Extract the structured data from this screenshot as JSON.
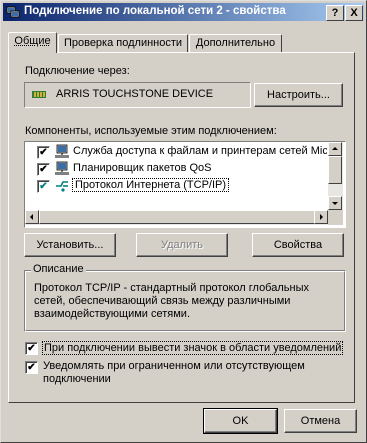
{
  "window": {
    "title": "Подключение по локальной сети 2 - свойства",
    "help_glyph": "?",
    "close_glyph": "X"
  },
  "tabs": [
    {
      "label": "Общие",
      "active": true
    },
    {
      "label": "Проверка подлинности",
      "active": false
    },
    {
      "label": "Дополнительно",
      "active": false
    }
  ],
  "connect_via": {
    "label": "Подключение через:",
    "device": "ARRIS TOUCHSTONE DEVICE",
    "configure_button": "Настроить..."
  },
  "components": {
    "label": "Компоненты, используемые этим подключением:",
    "items": [
      {
        "label": "Служба доступа к файлам и принтерам сетей Micro",
        "checked": true,
        "icon": "network-service-icon"
      },
      {
        "label": "Планировщик пакетов QoS",
        "checked": true,
        "icon": "network-service-icon"
      },
      {
        "label": "Протокол Интернета (TCP/IP)",
        "checked": true,
        "icon": "protocol-icon",
        "selected": true
      }
    ]
  },
  "buttons": {
    "install": "Установить...",
    "remove": "Удалить",
    "properties": "Свойства",
    "ok": "OK",
    "cancel": "Отмена"
  },
  "description": {
    "title": "Описание",
    "text": "Протокол TCP/IP - стандартный протокол глобальных сетей, обеспечивающий связь между различными взаимодействующими сетями."
  },
  "options": [
    {
      "label": "При подключении вывести значок в области уведомлений",
      "checked": true
    },
    {
      "label": "Уведомлять при ограниченном или отсутствующем подключении",
      "checked": true
    }
  ],
  "colors": {
    "title_start": "#0a246a",
    "title_end": "#a6caf0",
    "face": "#d4d0c8"
  }
}
